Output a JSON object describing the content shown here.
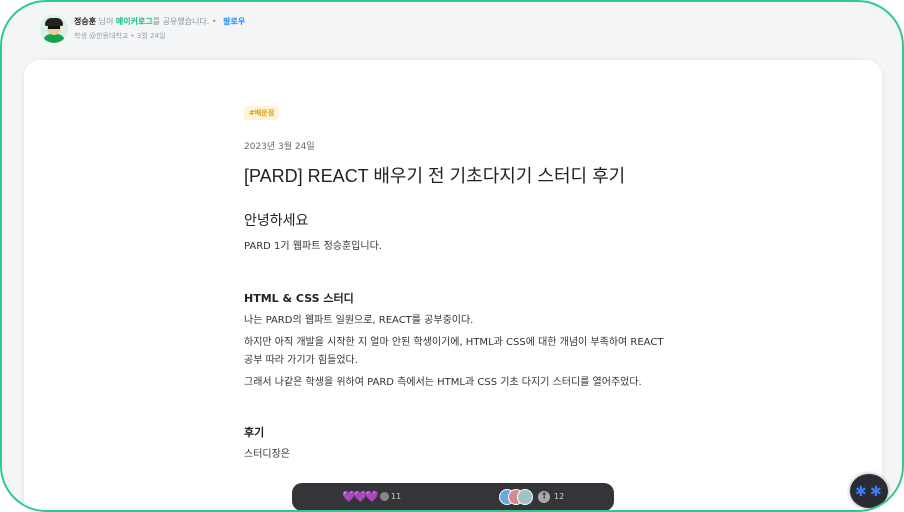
{
  "header": {
    "user_name": "정승훈",
    "connector": " 님이 ",
    "group_name": "메이커로그",
    "action": "를 공유했습니다.",
    "dot": "•",
    "follow_label": "팔로우",
    "affiliation": "학생 @한동대학교",
    "post_date": "3월 24일"
  },
  "article": {
    "tag": "#배운점",
    "date": "2023년 3월 24일",
    "title": "[PARD] REACT 배우기 전 기초다지기 스터디 후기",
    "greeting": "안녕하세요",
    "intro": "PARD 1기 웹파트 정승훈입니다.",
    "section1_heading": "HTML & CSS 스터디",
    "para1": "나는 PARD의 웹파트 일원으로, REACT를 공부중이다.",
    "para2": "하지만 아직 개발을 시작한 지 얼마 안된 학생이기에, HTML과 CSS에 대한 개념이 부족하여 REACT 공부 따라 가기가 힘들었다.",
    "para3": "그래서 나같은 학생을 위하여 PARD 측에서는 HTML과 CSS 기초 다지기 스터디를 열어주었다.",
    "section2_heading": "후기",
    "para4": "스터디장은"
  },
  "bottom_bar": {
    "hearts": "💜💜💜",
    "comment_count": "11",
    "upvote_icon": "arrow-up",
    "upvote_count": "12"
  },
  "colors": {
    "border": "#2ec98e",
    "group_name": "#16c07a",
    "follow": "#1a8cff",
    "tag_bg": "#fff4d6",
    "tag_text": "#e09b10",
    "bar_bg": "#333538"
  }
}
